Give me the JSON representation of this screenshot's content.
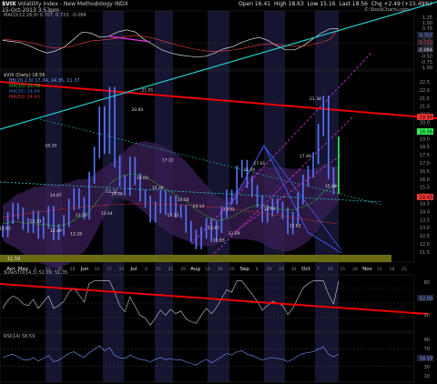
{
  "header": {
    "symbol": "$VIX",
    "name": "Volatility Index - New Methodology",
    "exchange": "INDX",
    "date": "15-Oct-2013 3:53pm",
    "open": "Open 16.41",
    "high": "High 18.63",
    "low": "Low 15.16",
    "last": "Last 18.56",
    "chg": "Chg +2.49 (+15.49%)",
    "watermark": "© StockCharts.com"
  },
  "colors": {
    "background": "#000000",
    "price": "#5577ff",
    "red_trend": "#ee0000",
    "cyan_trend": "#22cccc",
    "magenta": "#dd33dd",
    "bollinger_fill": "#3a1f55",
    "volume_band": "#6b6b14",
    "ma_green": "#33bb33",
    "ma_red": "#cc3333",
    "ma_blue": "#4466cc",
    "rsi": "#7799ff"
  },
  "macd_panel": {
    "label": "MACD(12,26,9) 0.707, 0.723, -0.084",
    "axis": [
      "1.25",
      "1.00",
      "0.75",
      "0.50",
      "0.25",
      "0.00",
      "-0.25",
      "-0.50",
      "-0.75",
      "-1.00"
    ],
    "last_labels": [
      "0.707",
      "0.723",
      "-0.084"
    ],
    "macd": [
      0.15,
      0.1,
      0.05,
      -0.1,
      -0.3,
      -0.45,
      -0.35,
      -0.15,
      0.2,
      0.55,
      0.5,
      0.3,
      0.35,
      0.55,
      0.65,
      0.55,
      0.2,
      -0.05,
      -0.3,
      -0.45,
      -0.55,
      -0.6,
      -0.65,
      -0.6,
      -0.45,
      -0.25,
      -0.15,
      0.05,
      0.2,
      0.3,
      0.15,
      -0.1,
      -0.3,
      -0.3,
      -0.1,
      0.2,
      0.5,
      0.7,
      0.71
    ],
    "signal": [
      0.2,
      0.17,
      0.13,
      0.06,
      -0.04,
      -0.16,
      -0.22,
      -0.2,
      -0.12,
      0.02,
      0.12,
      0.16,
      0.2,
      0.27,
      0.34,
      0.38,
      0.34,
      0.26,
      0.14,
      0.02,
      -0.1,
      -0.2,
      -0.29,
      -0.35,
      -0.37,
      -0.35,
      -0.31,
      -0.24,
      -0.15,
      -0.06,
      -0.02,
      -0.04,
      -0.09,
      -0.13,
      -0.12,
      -0.05,
      0.06,
      0.19,
      0.72
    ]
  },
  "price_panel": {
    "legend": [
      "$VIX (Daily) 18.56",
      "BB(20,2.0) 17.34, 14.35, 11.37",
      "MA(10) 15.78",
      "MA(20) 14.64",
      "MA(50) 14.40"
    ],
    "axis": [
      "22.5",
      "22.0",
      "21.5",
      "21.0",
      "20.5",
      "20.0",
      "19.5",
      "19.0",
      "18.5",
      "17.5",
      "17.0",
      "16.5",
      "16.0",
      "15.5",
      "15.0",
      "14.5",
      "14.0",
      "13.5",
      "13.0",
      "12.5",
      "12.0",
      "11.5"
    ],
    "tags": [
      "19.56",
      "18.56",
      "14.43"
    ],
    "annotations": [
      "12.62",
      "18.20",
      "14.87",
      "13.13",
      "12.49",
      "13.53",
      "12.26",
      "15.11",
      "13.64",
      "14.96",
      "20.60",
      "21.91",
      "16.03",
      "15.36",
      "17.22",
      "13.53",
      "14.56",
      "14.14",
      "12.67",
      "11.83",
      "13.91",
      "12.29",
      "16.56",
      "17.01",
      "13.96",
      "12.82",
      "17.49",
      "21.34",
      "15.48"
    ],
    "volume_label": "11.59"
  },
  "chart_data": {
    "type": "line",
    "title": "$VIX Volatility Index - New Methodology",
    "x": [
      "Apr",
      "May",
      "6",
      "13",
      "20",
      "28",
      "Jun",
      "10",
      "17",
      "24",
      "Jul",
      "8",
      "15",
      "22",
      "29",
      "Aug",
      "12",
      "19",
      "26",
      "Sep",
      "9",
      "16",
      "23",
      "30",
      "Oct",
      "7",
      "14",
      "21",
      "28",
      "Nov",
      "11",
      "18",
      "25"
    ],
    "xlabel": "",
    "ylabel": "",
    "ylim": [
      11.2,
      22.8
    ],
    "series": [
      {
        "name": "$VIX (Daily) 18.56",
        "values": [
          12.6,
          13.5,
          14.1,
          13.8,
          13.1,
          12.9,
          13.6,
          12.5,
          13.2,
          13.9,
          12.4,
          12.7,
          13.3,
          14.4,
          15.1,
          14.5,
          13.8,
          16.2,
          17.9,
          20.6,
          18.2,
          21.9,
          17.3,
          16.0,
          15.4,
          17.2,
          16.1,
          15.0,
          14.6,
          13.6,
          14.2,
          14.9,
          14.1,
          14.6,
          13.9,
          14.0,
          12.9,
          12.3,
          11.8,
          12.5,
          13.1,
          12.3,
          12.9,
          13.9,
          15.0,
          14.8,
          16.6,
          17.0,
          15.9,
          15.3,
          14.6,
          13.6,
          14.0,
          14.4,
          14.2,
          13.8,
          12.8,
          13.5,
          14.8,
          16.0,
          16.6,
          17.5,
          19.4,
          21.3,
          16.5,
          15.5,
          18.56
        ]
      },
      {
        "name": "MA(20) 14.64",
        "values": [
          13.2,
          13.2,
          13.3,
          13.3,
          13.2,
          13.2,
          13.2,
          13.1,
          13.1,
          13.1,
          13.0,
          13.0,
          13.1,
          13.2,
          13.4,
          13.6,
          13.7,
          14.0,
          14.4,
          14.9,
          15.3,
          15.8,
          16.1,
          16.3,
          16.4,
          16.5,
          16.5,
          16.4,
          16.3,
          16.1,
          15.9,
          15.7,
          15.5,
          15.3,
          15.1,
          14.9,
          14.7,
          14.4,
          14.1,
          13.9,
          13.7,
          13.5,
          13.4,
          13.4,
          13.5,
          13.6,
          13.8,
          14.0,
          14.2,
          14.3,
          14.4,
          14.4,
          14.3,
          14.2,
          14.2,
          14.1,
          14.1,
          14.1,
          14.2,
          14.3,
          14.4,
          14.6,
          14.9,
          15.3,
          15.5,
          15.6,
          15.8
        ]
      }
    ],
    "legend": "top-left",
    "grid": false
  },
  "rsi_panel": {
    "label": "RSI(14) 58.59",
    "axis": [
      "90",
      "70",
      "50",
      "30",
      "10"
    ],
    "tag": "58.59",
    "values": [
      50,
      55,
      58,
      52,
      45,
      44,
      50,
      42,
      48,
      55,
      40,
      44,
      52,
      60,
      64,
      56,
      50,
      62,
      70,
      78,
      66,
      74,
      55,
      50,
      48,
      56,
      50,
      46,
      44,
      40,
      46,
      50,
      45,
      48,
      44,
      45,
      40,
      36,
      32,
      40,
      46,
      38,
      44,
      52,
      60,
      56,
      64,
      66,
      58,
      55,
      50,
      44,
      48,
      50,
      48,
      46,
      40,
      46,
      54,
      60,
      62,
      64,
      70,
      76,
      58,
      52,
      58.59
    ]
  },
  "oscillator_panel": {
    "label": "SlowSTO(14,3) 52.09, 51.35",
    "axis": [
      "80",
      "50",
      "20"
    ],
    "tag": "52.09"
  }
}
